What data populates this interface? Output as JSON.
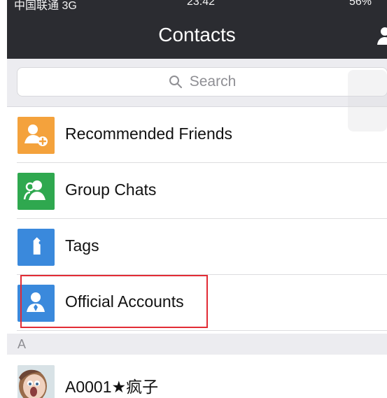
{
  "status": {
    "carrier": "中国联通 3G",
    "time": "23:42",
    "battery": "56%"
  },
  "header": {
    "title": "Contacts",
    "right_icon": "add-contact-icon"
  },
  "search": {
    "placeholder": "Search"
  },
  "rows": [
    {
      "label": "Recommended Friends",
      "icon": "recommended-friends-icon",
      "color": "#f4a23c"
    },
    {
      "label": "Group Chats",
      "icon": "group-chats-icon",
      "color": "#2fa84f"
    },
    {
      "label": "Tags",
      "icon": "tag-icon",
      "color": "#3a89dc"
    },
    {
      "label": "Official Accounts",
      "icon": "official-accounts-icon",
      "color": "#3a89dc"
    }
  ],
  "section": {
    "letter": "A"
  },
  "contact": {
    "name": "A0001★疯子",
    "avatar": "contact-avatar"
  },
  "highlight": {
    "color": "#e22c35"
  }
}
